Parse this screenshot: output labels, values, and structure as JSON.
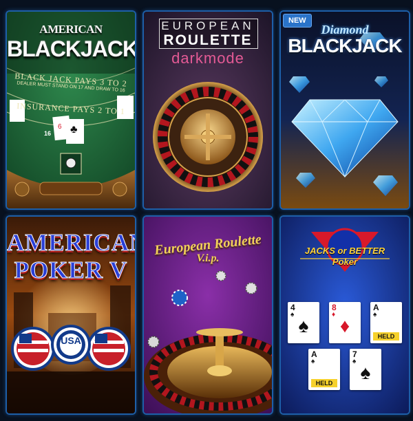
{
  "tiles": [
    {
      "id": "american-blackjack",
      "title_line1": "AMERICAN",
      "title_line2": "BLACKJACK",
      "table_texts": [
        "BLACK JACK PAYS 3 TO 2",
        "DEALER MUST STAND ON 17 AND DRAW TO 16",
        "INSURANCE PAYS 2 TO 1"
      ],
      "score": "16"
    },
    {
      "id": "european-roulette-darkmode",
      "title_line1": "EUROPEAN",
      "title_line2": "ROULETTE",
      "subtitle": "darkmode"
    },
    {
      "id": "diamond-blackjack",
      "badge": "NEW",
      "title_line1": "Diamond",
      "title_line2": "BLACKJACK"
    },
    {
      "id": "american-poker-v",
      "title_line1": "AMERICAN",
      "title_line2": "POKER V",
      "chip_text": "USA"
    },
    {
      "id": "european-roulette-vip",
      "title_line1": "European Roulette",
      "title_line2": "V.i.p."
    },
    {
      "id": "jacks-or-better-poker",
      "title_line1": "JACKS or BETTER",
      "title_line2": "Poker",
      "cards": [
        {
          "rank": "4",
          "suit": "♠",
          "color": "black",
          "held": false
        },
        {
          "rank": "8",
          "suit": "♦",
          "color": "red",
          "held": false
        },
        {
          "rank": "A",
          "suit": "♠",
          "color": "black",
          "held": true
        },
        {
          "rank": "A",
          "suit": "♠",
          "color": "black",
          "held": true
        },
        {
          "rank": "7",
          "suit": "♠",
          "color": "black",
          "held": false
        }
      ],
      "held_label": "HELD"
    }
  ],
  "colors": {
    "background": "#08111f",
    "tile_border": "#1d5fa8",
    "badge": "#2a73c9",
    "felt_green": "#1f6b3a",
    "darkmode_pink": "#e45a95",
    "gold": "#f2d15a",
    "held_yellow": "#f6d12b"
  }
}
